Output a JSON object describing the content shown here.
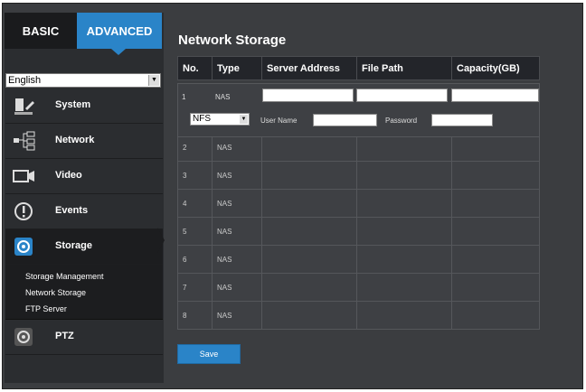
{
  "tabs": {
    "basic": "BASIC",
    "advanced": "ADVANCED"
  },
  "language": {
    "selected": "English"
  },
  "menu": {
    "items": [
      {
        "label": "System",
        "icon": "system-icon"
      },
      {
        "label": "Network",
        "icon": "network-icon"
      },
      {
        "label": "Video",
        "icon": "video-icon"
      },
      {
        "label": "Events",
        "icon": "events-icon"
      },
      {
        "label": "Storage",
        "icon": "storage-icon"
      },
      {
        "label": "PTZ",
        "icon": "ptz-icon"
      }
    ],
    "storage_sub": [
      "Storage Management",
      "Network Storage",
      "FTP Server"
    ]
  },
  "page": {
    "title": "Network Storage"
  },
  "table": {
    "headers": [
      "No.",
      "Type",
      "Server Address",
      "File Path",
      "Capacity(GB)"
    ],
    "row1": {
      "no": "1",
      "type": "NAS",
      "server_address": "",
      "file_path": "",
      "capacity": "",
      "protocol": "NFS",
      "user_name_label": "User Name",
      "user_name": "",
      "password_label": "Password",
      "password": ""
    },
    "rows": [
      {
        "no": "2",
        "type": "NAS"
      },
      {
        "no": "3",
        "type": "NAS"
      },
      {
        "no": "4",
        "type": "NAS"
      },
      {
        "no": "5",
        "type": "NAS"
      },
      {
        "no": "6",
        "type": "NAS"
      },
      {
        "no": "7",
        "type": "NAS"
      },
      {
        "no": "8",
        "type": "NAS"
      }
    ]
  },
  "buttons": {
    "save": "Save"
  },
  "colors": {
    "accent": "#2a84c8",
    "panel": "#3b3d40",
    "sidebar": "#2b2d30"
  }
}
